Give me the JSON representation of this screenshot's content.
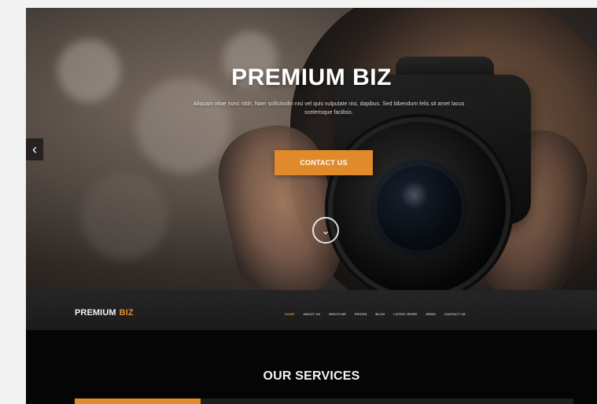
{
  "hero": {
    "title": "PREMIUM BIZ",
    "subtitle": "Aliquam vitae nunc nibh. Nam sollicitudin nisi vel quis vulputate nisi, dapibus. Sed bibendum felis sit amet lacus scelerisque facilisis.",
    "cta_label": "CONTACT US",
    "prev_icon": "‹",
    "scroll_icon": "⌄"
  },
  "nav": {
    "brand_main": "PREMIUM",
    "brand_accent": "BIZ",
    "items": [
      "HOME",
      "ABOUT US",
      "WHO'S WE",
      "PRICES",
      "BLOG",
      "LATEST WORK",
      "NEWS",
      "CONTACT US"
    ],
    "active_index": 0
  },
  "services": {
    "title": "OUR SERVICES"
  },
  "colors": {
    "accent": "#e08a2b",
    "nav_bg": "#1f1f1f",
    "services_bg": "#050505"
  },
  "icons": {
    "prev": "chevron-left-icon",
    "scroll": "chevron-down-circle-icon"
  }
}
